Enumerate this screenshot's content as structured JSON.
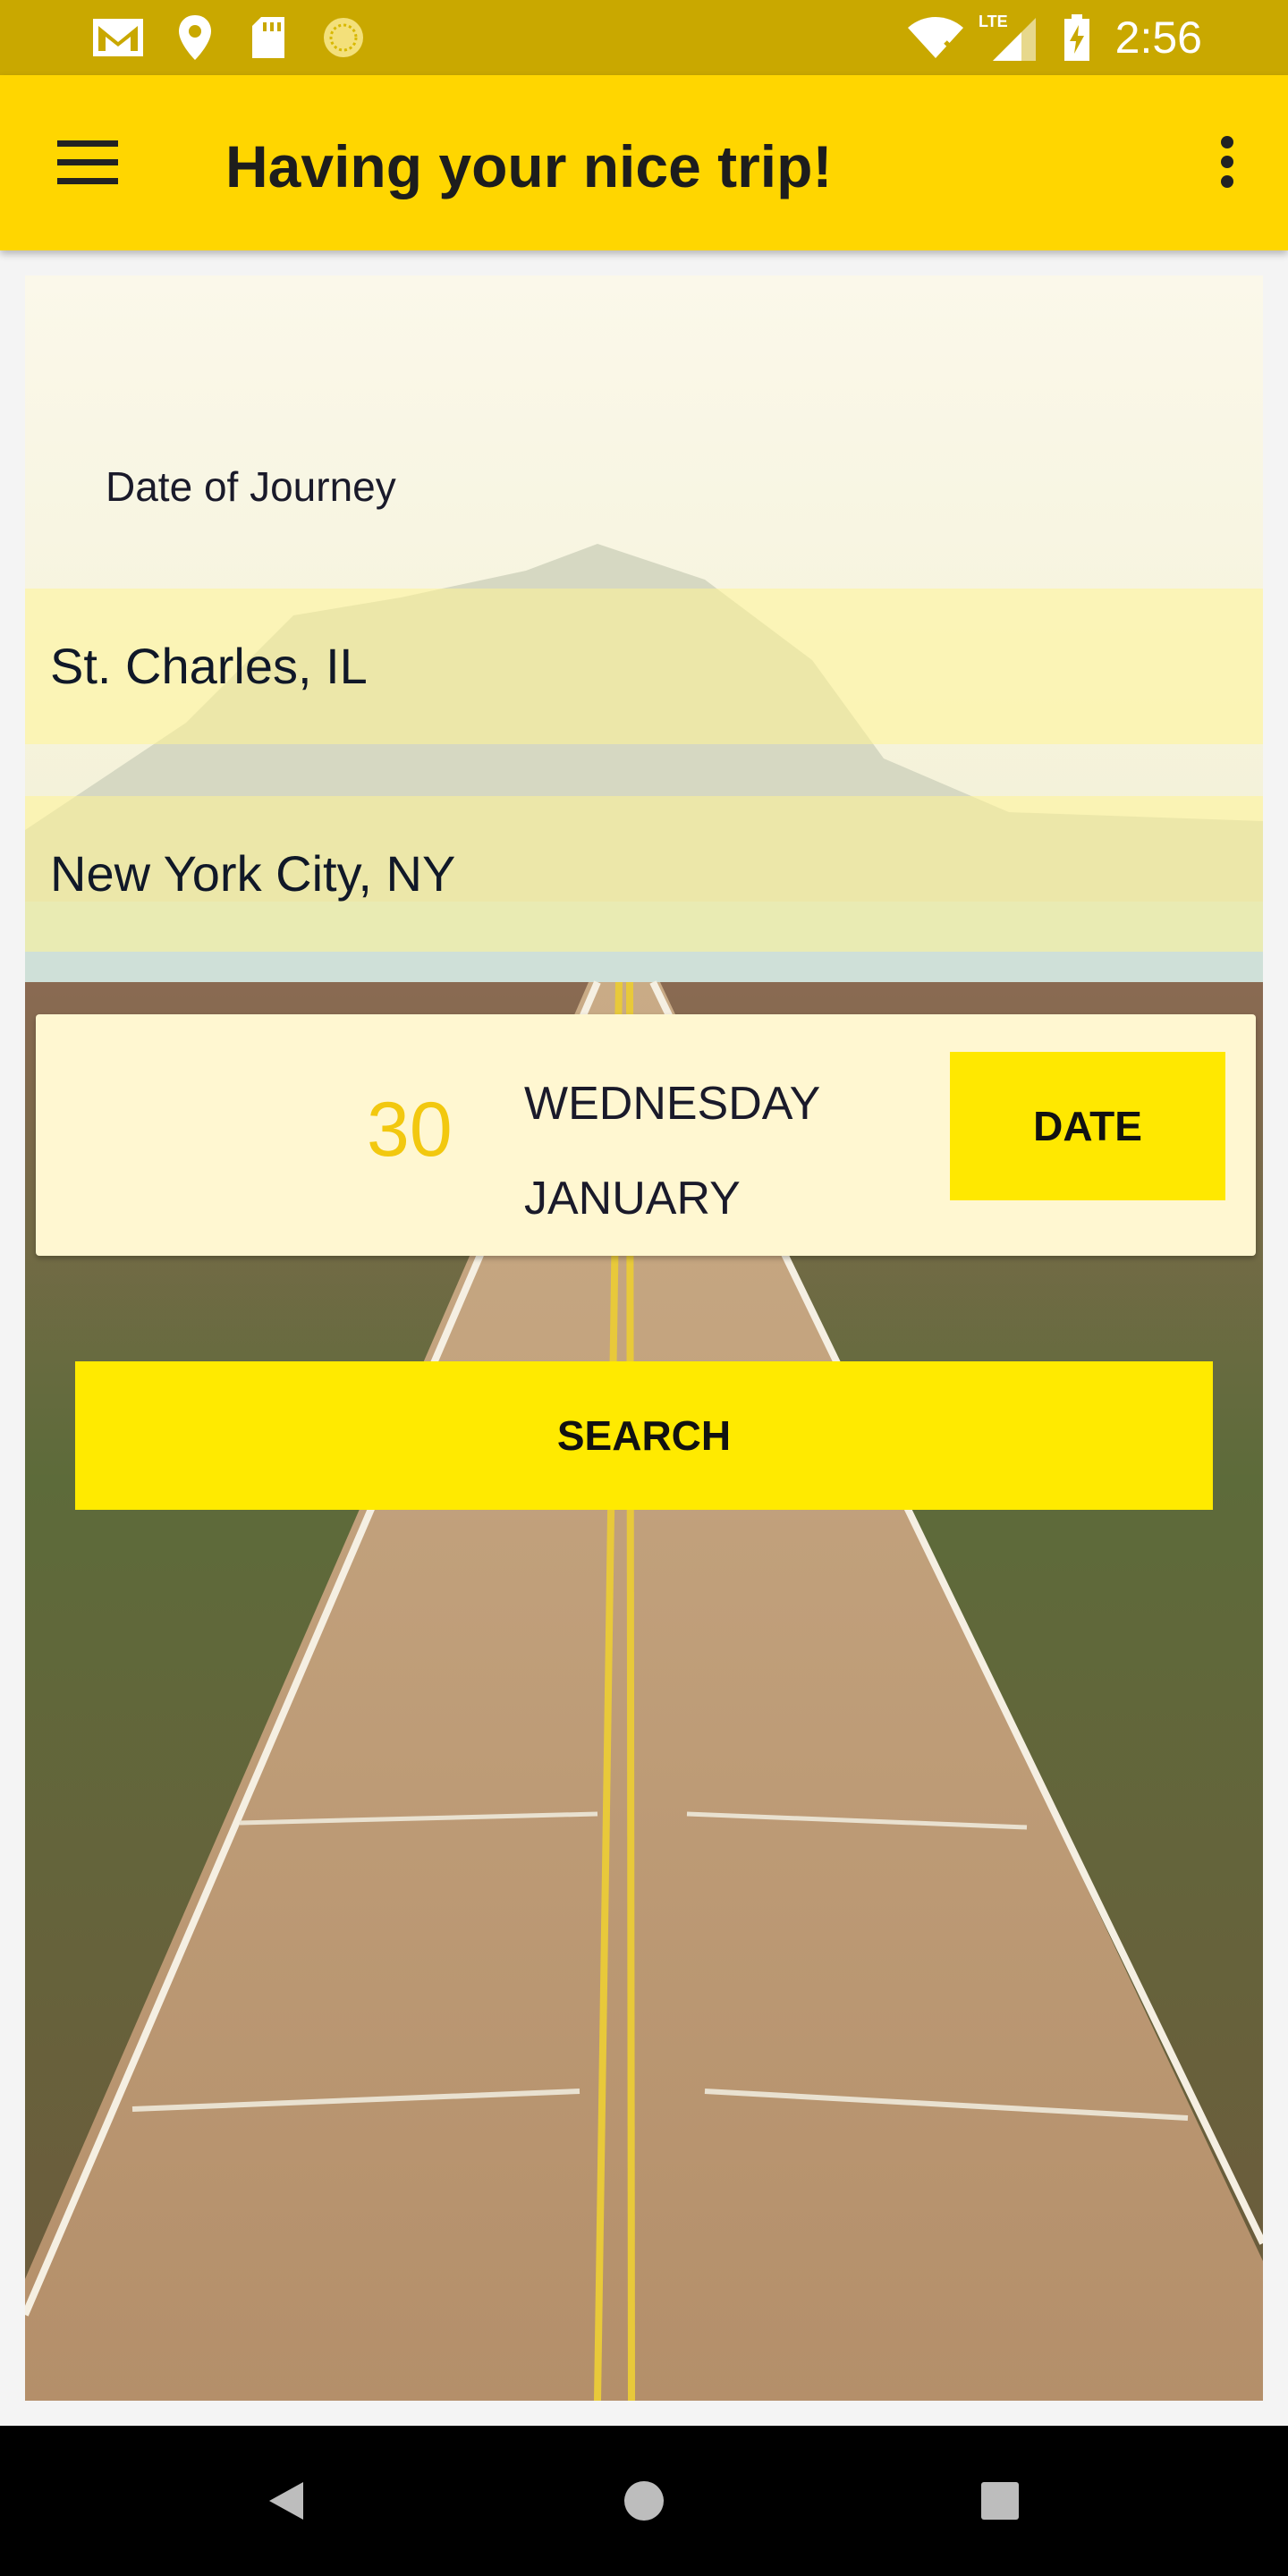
{
  "status_bar": {
    "time": "2:56",
    "network": "LTE",
    "icons": [
      "gmail-icon",
      "location-icon",
      "sd-card-icon",
      "sync-icon",
      "wifi-icon",
      "signal-icon",
      "battery-charging-icon"
    ]
  },
  "app_bar": {
    "title": "Having your nice trip!",
    "color": "#ffd600"
  },
  "form": {
    "date_label": "Date of Journey",
    "from_value": "St. Charles, IL",
    "to_value": "New York City, NY"
  },
  "date_picker": {
    "day": "30",
    "weekday": "WEDNESDAY",
    "month": "JANUARY",
    "button_label": "DATE"
  },
  "search": {
    "button_label": "SEARCH"
  },
  "nav_bar": {
    "buttons": [
      "back-icon",
      "home-icon",
      "recents-icon"
    ]
  },
  "colors": {
    "accent": "#ffe800",
    "day_text": "#f2c80f",
    "status_bar": "#c9a800"
  }
}
